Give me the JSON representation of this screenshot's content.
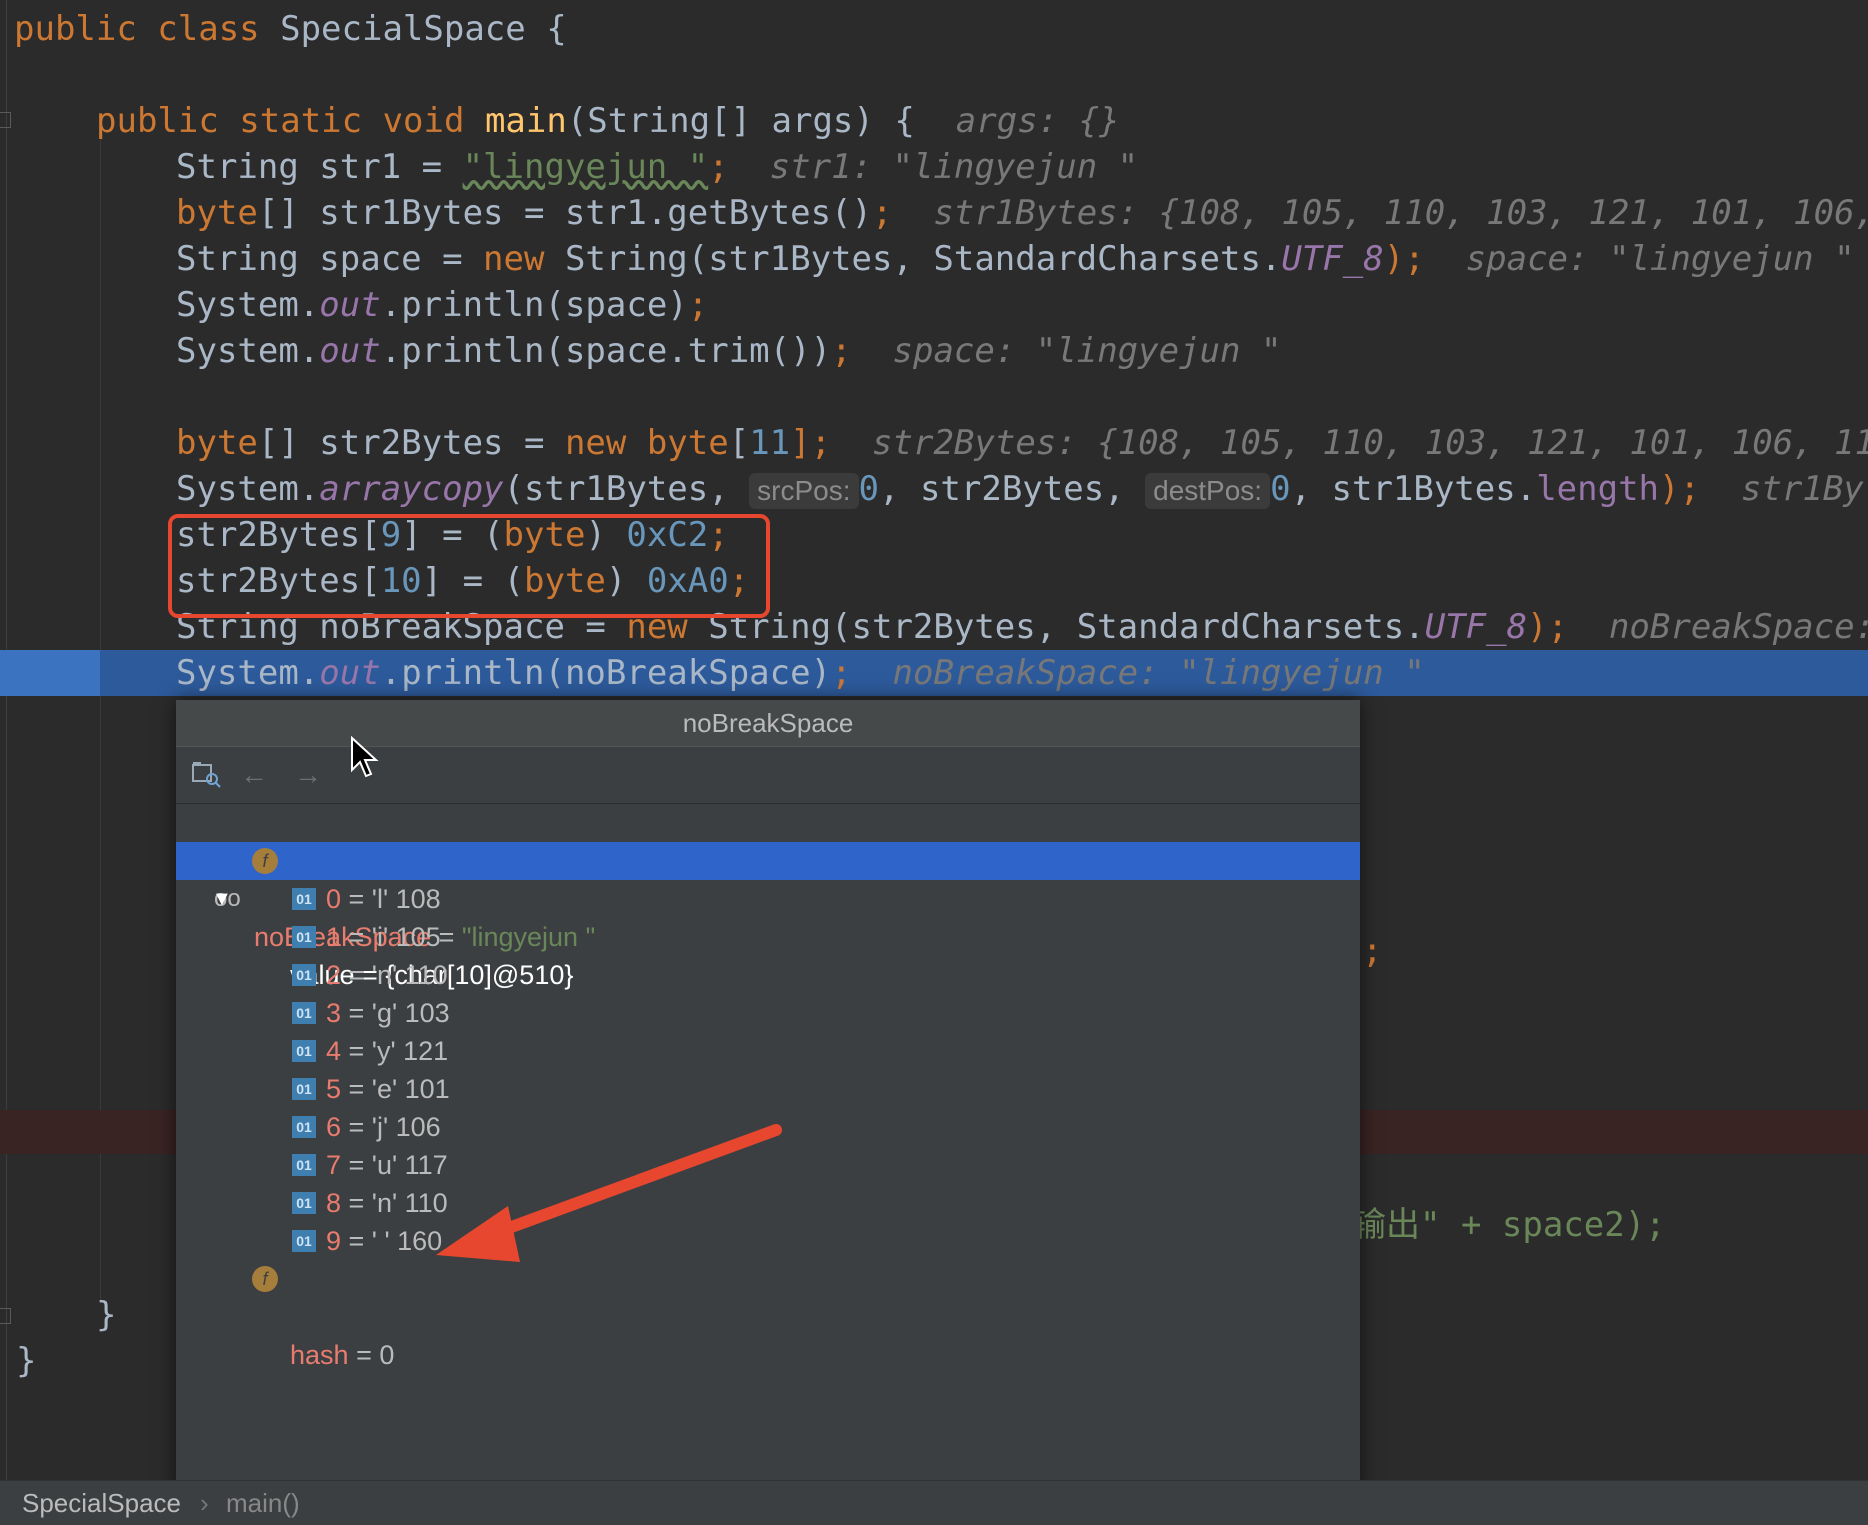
{
  "code": {
    "l1": {
      "kw": "public class ",
      "name": "SpecialSpace",
      "rest": " {"
    },
    "l2": {
      "kw": "public static void ",
      "fn": "main",
      "sig": "(String[] args) {",
      "hint": "args: {}"
    },
    "l3": {
      "a": "String str1 = ",
      "s": "\"lingyejun \"",
      "b": ";",
      "hint": "str1: \"lingyejun \""
    },
    "l4": {
      "kw": "byte",
      "a": "[] str1Bytes = str1.getBytes()",
      "b": ";",
      "hint": "str1Bytes: {108, 105, 110, 103, 121, 101, 106, 1"
    },
    "l5": {
      "a": "String space = ",
      "kw": "new ",
      "b": "String(str1Bytes, StandardCharsets.",
      "f": "UTF_8",
      "c": ");",
      "hint": "space: \"lingyejun \""
    },
    "l6": {
      "a": "System.",
      "f": "out",
      "b": ".println(space)",
      "c": ";"
    },
    "l7": {
      "a": "System.",
      "f": "out",
      "b": ".println(space.trim())",
      "c": ";",
      "hint": "space: \"lingyejun \""
    },
    "l8": {
      "kw1": "byte",
      "a": "[] str2Bytes = ",
      "kw2": "new byte",
      "b": "[",
      "n": "11",
      "c": "];",
      "hint": "str2Bytes: {108, 105, 110, 103, 121, 101, 106, 117,"
    },
    "l9": {
      "a": "System.",
      "f": "arraycopy",
      "b": "(str1Bytes, ",
      "p1": "srcPos:",
      "n1": "0",
      "c": ", str2Bytes, ",
      "p2": "destPos:",
      "n2": "0",
      "d": ", str1Bytes.",
      "len": "length",
      "e": ");",
      "hint": "str1By"
    },
    "l10": {
      "a": "str2Bytes[",
      "n1": "9",
      "b": "] = (",
      "kw": "byte",
      "c": ") ",
      "n2": "0xC2",
      "d": ";"
    },
    "l11": {
      "a": "str2Bytes[",
      "n1": "10",
      "b": "] = (",
      "kw": "byte",
      "c": ") ",
      "n2": "0xA0",
      "d": ";"
    },
    "l12": {
      "a": "String noBreakSpace = ",
      "kw": "new ",
      "b": "String(str2Bytes, StandardCharsets.",
      "f": "UTF_8",
      "c": ");",
      "hint": "noBreakSpace: \""
    },
    "l13": {
      "a": "System.",
      "f": "out",
      "b": ".println(noBreakSpace)",
      "c": ";",
      "hint": "noBreakSpace: \"lingyejun \""
    },
    "peek1": ";",
    "peek2": "输出\" + space2);",
    "close1": "}",
    "close2": "}"
  },
  "popup": {
    "title": "noBreakSpace",
    "root": {
      "name": "noBreakSpace",
      "eq": " = ",
      "value": "\"lingyejun \""
    },
    "value_row": {
      "name": "value",
      "rest": " = {char[10]@510}"
    },
    "items": [
      {
        "idx": "0",
        "rest": " = 'l' 108"
      },
      {
        "idx": "1",
        "rest": " = 'i' 105"
      },
      {
        "idx": "2",
        "rest": " = 'n' 110"
      },
      {
        "idx": "3",
        "rest": " = 'g' 103"
      },
      {
        "idx": "4",
        "rest": " = 'y' 121"
      },
      {
        "idx": "5",
        "rest": " = 'e' 101"
      },
      {
        "idx": "6",
        "rest": " = 'j' 106"
      },
      {
        "idx": "7",
        "rest": " = 'u' 117"
      },
      {
        "idx": "8",
        "rest": " = 'n' 110"
      },
      {
        "idx": "9",
        "rest": " = ' ' 160"
      }
    ],
    "hash_row": {
      "name": "hash",
      "rest": " = 0"
    },
    "icon_label_field": "f",
    "icon_label_byte": "01"
  },
  "status": {
    "crumb1": "SpecialSpace",
    "sep": "›",
    "crumb2": "main()"
  },
  "colors": {
    "annotation": "#e8472f",
    "selection": "#2f65ca",
    "current_line": "#2d5a9b"
  }
}
